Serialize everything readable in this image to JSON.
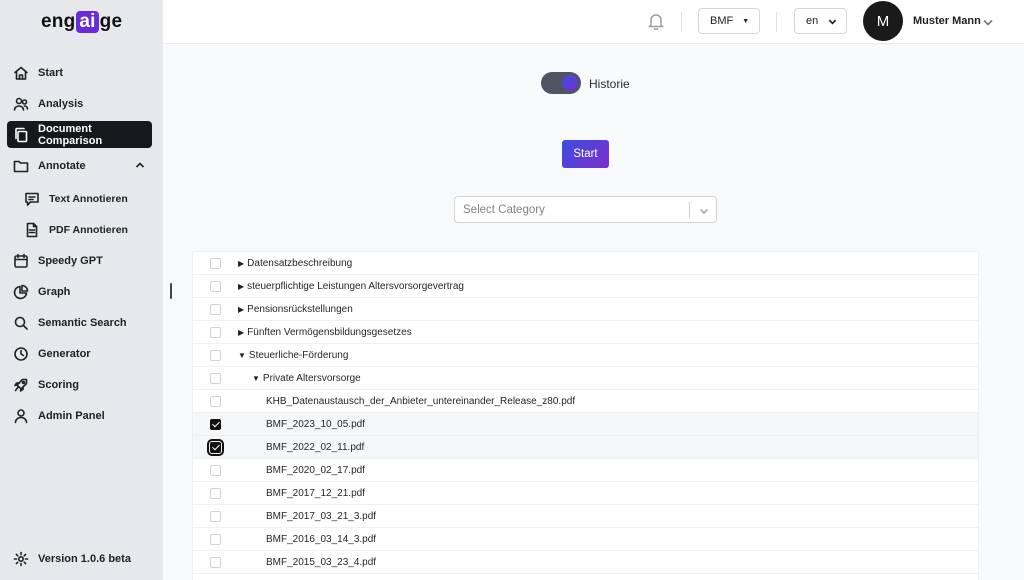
{
  "logo": {
    "pre": "eng",
    "ai": "ai",
    "post": "ge"
  },
  "sidebar": {
    "items": [
      {
        "label": "Start",
        "icon": "home-icon"
      },
      {
        "label": "Analysis",
        "icon": "users-icon"
      },
      {
        "label": "Document Comparison",
        "icon": "copy-icon",
        "active": true
      },
      {
        "label": "Annotate",
        "icon": "folder-icon",
        "expanded": true
      },
      {
        "label": "Text Annotieren",
        "icon": "message-icon"
      },
      {
        "label": "PDF Annotieren",
        "icon": "file-icon"
      },
      {
        "label": "Speedy GPT",
        "icon": "calendar-icon"
      },
      {
        "label": "Graph",
        "icon": "pie-chart-icon"
      },
      {
        "label": "Semantic Search",
        "icon": "search-icon"
      },
      {
        "label": "Generator",
        "icon": "clock-icon"
      },
      {
        "label": "Scoring",
        "icon": "rocket-icon"
      },
      {
        "label": "Admin Panel",
        "icon": "user-icon"
      }
    ],
    "version": "Version 1.0.6 beta"
  },
  "header": {
    "org_select": "BMF",
    "lang_select": "en",
    "avatar_initial": "M",
    "user_name": "Muster Mann"
  },
  "main": {
    "toggle_label": "Historie",
    "toggle_on": true,
    "start_button": "Start",
    "category_placeholder": "Select Category"
  },
  "tree": [
    {
      "label": "Datensatzbeschreibung",
      "type": "folder",
      "expanded": false,
      "level": 0,
      "checked": false
    },
    {
      "label": "steuerpflichtige Leistungen Altersvorsorgevertrag",
      "type": "folder",
      "expanded": false,
      "level": 0,
      "checked": false
    },
    {
      "label": "Pensionsrückstellungen",
      "type": "folder",
      "expanded": false,
      "level": 0,
      "checked": false
    },
    {
      "label": "Fünften Vermögensbildungsgesetzes",
      "type": "folder",
      "expanded": false,
      "level": 0,
      "checked": false
    },
    {
      "label": "Steuerliche-Förderung",
      "type": "folder",
      "expanded": true,
      "level": 0,
      "checked": false
    },
    {
      "label": "Private Altersvorsorge",
      "type": "folder",
      "expanded": true,
      "level": 1,
      "checked": false
    },
    {
      "label": "KHB_Datenaustausch_der_Anbieter_untereinander_Release_z80.pdf",
      "type": "file",
      "level": 2,
      "checked": false
    },
    {
      "label": "BMF_2023_10_05.pdf",
      "type": "file",
      "level": 2,
      "checked": true
    },
    {
      "label": "BMF_2022_02_11.pdf",
      "type": "file",
      "level": 2,
      "checked": true
    },
    {
      "label": "BMF_2020_02_17.pdf",
      "type": "file",
      "level": 2,
      "checked": false
    },
    {
      "label": "BMF_2017_12_21.pdf",
      "type": "file",
      "level": 2,
      "checked": false
    },
    {
      "label": "BMF_2017_03_21_3.pdf",
      "type": "file",
      "level": 2,
      "checked": false
    },
    {
      "label": "BMF_2016_03_14_3.pdf",
      "type": "file",
      "level": 2,
      "checked": false
    },
    {
      "label": "BMF_2015_03_23_4.pdf",
      "type": "file",
      "level": 2,
      "checked": false
    }
  ],
  "colors": {
    "accent_start": "#3a4fe0",
    "accent_end": "#7d2ccf",
    "active_nav": "#16181b"
  }
}
